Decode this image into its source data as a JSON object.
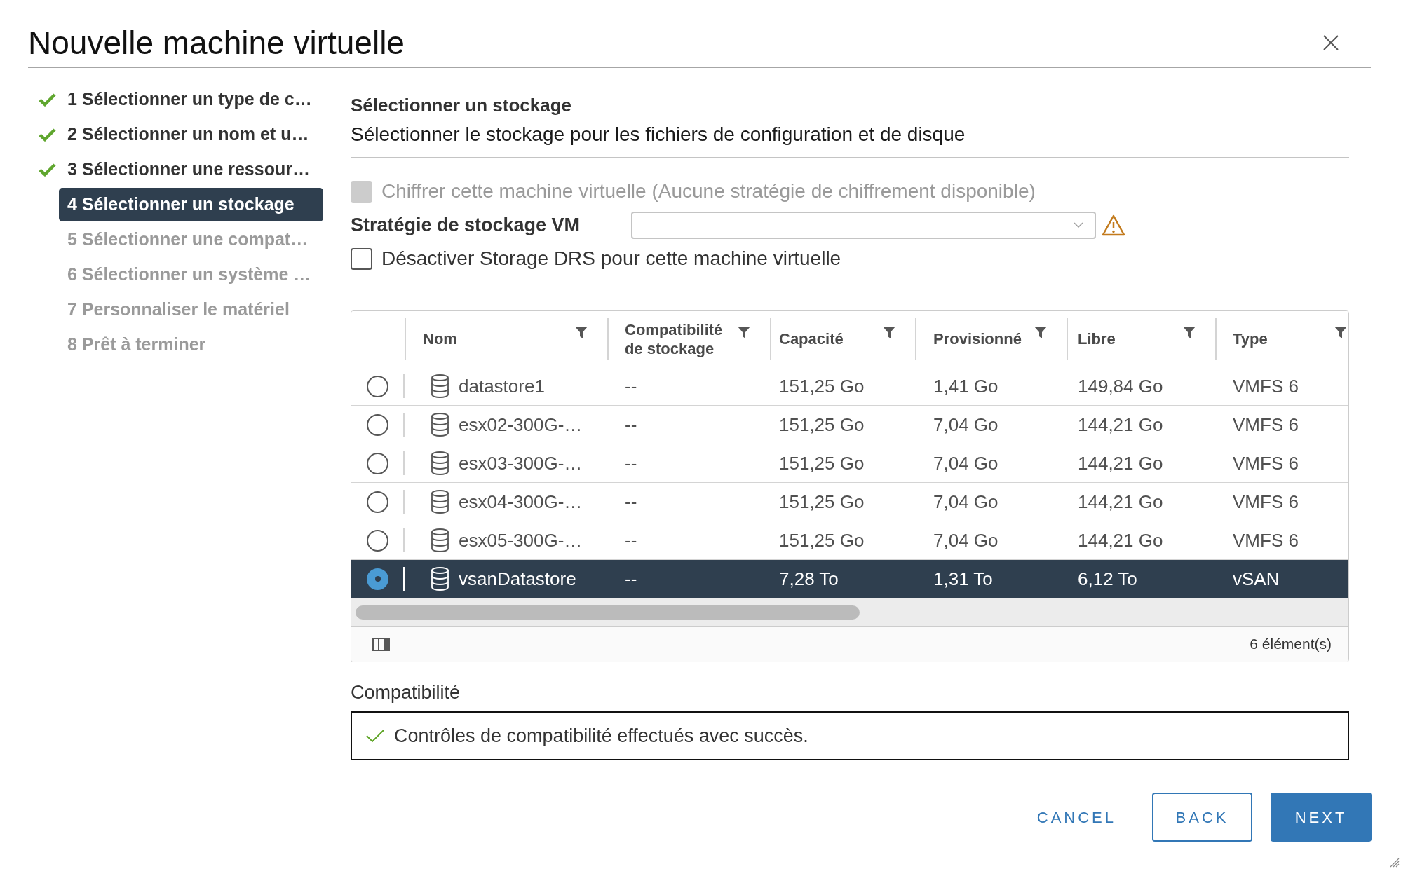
{
  "dialog": {
    "title": "Nouvelle machine virtuelle"
  },
  "steps": [
    {
      "label": "1 Sélectionner un type de c…",
      "completed": true,
      "selected": false,
      "disabled": false
    },
    {
      "label": "2 Sélectionner un nom et u…",
      "completed": true,
      "selected": false,
      "disabled": false
    },
    {
      "label": "3 Sélectionner une ressour…",
      "completed": true,
      "selected": false,
      "disabled": false
    },
    {
      "label": "4 Sélectionner un stockage",
      "completed": false,
      "selected": true,
      "disabled": false
    },
    {
      "label": "5 Sélectionner une compat…",
      "completed": false,
      "selected": false,
      "disabled": true
    },
    {
      "label": "6 Sélectionner un système …",
      "completed": false,
      "selected": false,
      "disabled": true
    },
    {
      "label": "7 Personnaliser le matériel",
      "completed": false,
      "selected": false,
      "disabled": true
    },
    {
      "label": "8 Prêt à terminer",
      "completed": false,
      "selected": false,
      "disabled": true
    }
  ],
  "page": {
    "heading": "Sélectionner un stockage",
    "description": "Sélectionner le stockage pour les fichiers de configuration et de disque"
  },
  "encrypt_option": {
    "label": "Chiffrer cette machine virtuelle (Aucune stratégie de chiffrement disponible)",
    "checked": false,
    "disabled": true
  },
  "storage_policy": {
    "label": "Stratégie de stockage VM",
    "warning": true
  },
  "drs_option": {
    "label": "Désactiver Storage DRS pour cette machine virtuelle",
    "checked": false,
    "disabled": false
  },
  "table": {
    "columns": [
      {
        "label": "Nom",
        "filter": true
      },
      {
        "label": "Compatibilité de stockage",
        "filter": true
      },
      {
        "label": "Capacité",
        "filter": true
      },
      {
        "label": "Provisionné",
        "filter": true
      },
      {
        "label": "Libre",
        "filter": true
      },
      {
        "label": "Type",
        "filter": true
      }
    ],
    "rows": [
      {
        "selected": false,
        "cells": [
          "datastore1",
          "--",
          "151,25 Go",
          "1,41 Go",
          "149,84 Go",
          "VMFS 6"
        ]
      },
      {
        "selected": false,
        "cells": [
          "esx02-300G-…",
          "--",
          "151,25 Go",
          "7,04 Go",
          "144,21 Go",
          "VMFS 6"
        ]
      },
      {
        "selected": false,
        "cells": [
          "esx03-300G-…",
          "--",
          "151,25 Go",
          "7,04 Go",
          "144,21 Go",
          "VMFS 6"
        ]
      },
      {
        "selected": false,
        "cells": [
          "esx04-300G-…",
          "--",
          "151,25 Go",
          "7,04 Go",
          "144,21 Go",
          "VMFS 6"
        ]
      },
      {
        "selected": false,
        "cells": [
          "esx05-300G-…",
          "--",
          "151,25 Go",
          "7,04 Go",
          "144,21 Go",
          "VMFS 6"
        ]
      },
      {
        "selected": true,
        "cells": [
          "vsanDatastore",
          "--",
          "7,28 To",
          "1,31 To",
          "6,12 To",
          "vSAN"
        ]
      }
    ],
    "count": "6 élément(s)"
  },
  "compatibility": {
    "label": "Compatibilité",
    "passed": true,
    "message": "Contrôles de compatibilité effectués avec succès."
  },
  "buttons": [
    {
      "label": "CANCEL",
      "kind": "flat"
    },
    {
      "label": "BACK",
      "kind": "outline"
    },
    {
      "label": "NEXT",
      "kind": "primary"
    }
  ]
}
